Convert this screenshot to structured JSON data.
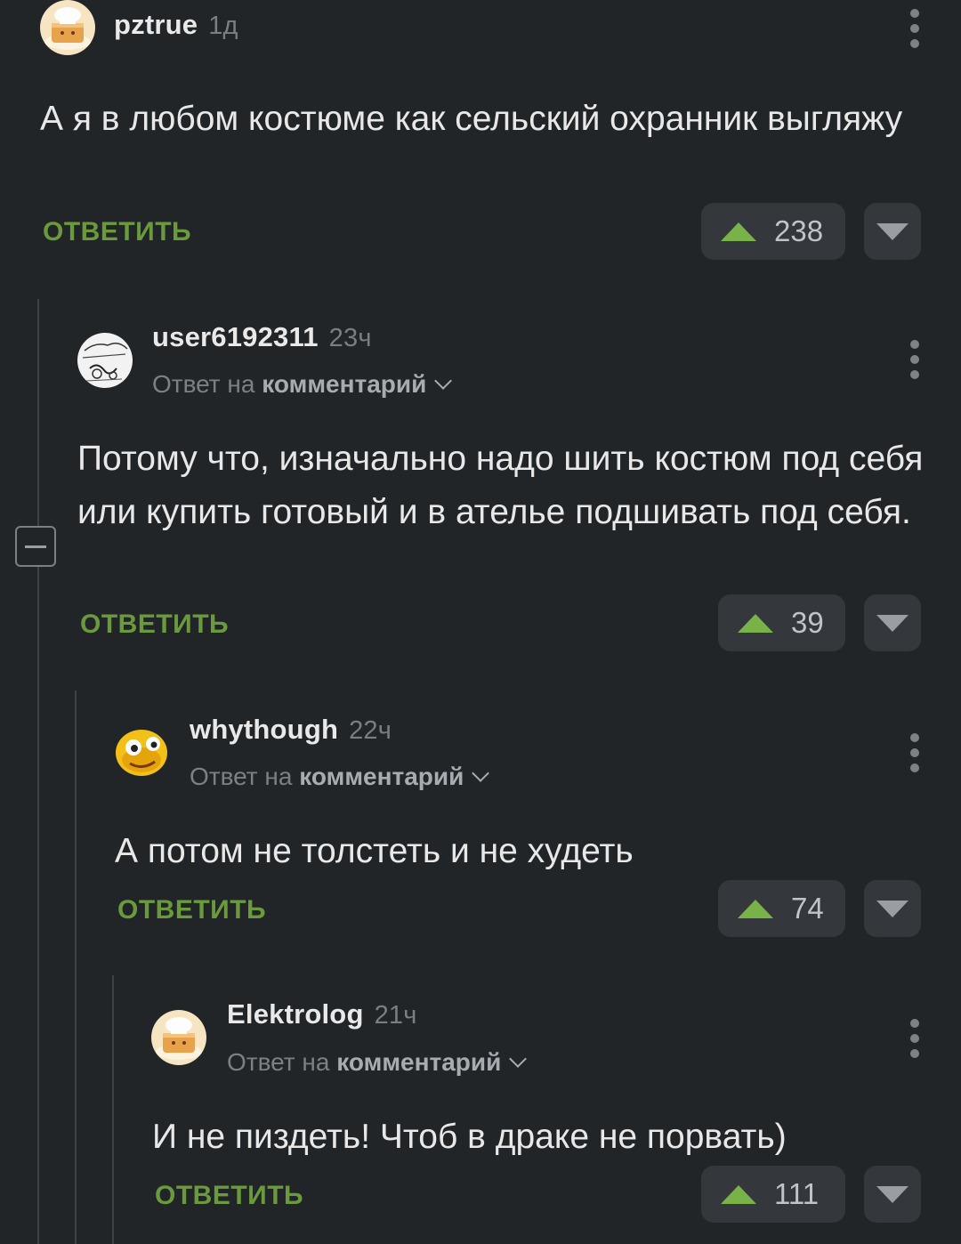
{
  "comments": [
    {
      "username": "pztrue",
      "time": "1д",
      "text": "А я в любом костюме как сельский охранник выгляжу",
      "reply_label": "ОТВЕТИТЬ",
      "score": "238",
      "avatar": "chef-cake-avatar"
    },
    {
      "username": "user6192311",
      "time": "23ч",
      "reply_prefix": "Ответ на",
      "reply_link": "комментарий",
      "text": "Потому что, изначально надо шить костюм под себя или купить готовый и в ателье подшивать под себя.",
      "reply_label": "ОТВЕТИТЬ",
      "score": "39",
      "avatar": "sketch-meme-avatar"
    },
    {
      "username": "whythough",
      "time": "22ч",
      "reply_prefix": "Ответ на",
      "reply_link": "комментарий",
      "text": "А потом не толстеть и не худеть",
      "reply_label": "ОТВЕТИТЬ",
      "score": "74",
      "avatar": "yellow-face-avatar"
    },
    {
      "username": "Elektrolog",
      "time": "21ч",
      "reply_prefix": "Ответ на",
      "reply_link": "комментарий",
      "text": "И не пиздеть! Чтоб в драке не порвать)",
      "reply_label": "ОТВЕТИТЬ",
      "score": "111",
      "avatar": "chef-cake-avatar"
    }
  ],
  "colors": {
    "background": "#222528",
    "accent_green": "#6a9a3c",
    "upvote_green": "#7ab24a",
    "button_bg": "#34383c"
  }
}
